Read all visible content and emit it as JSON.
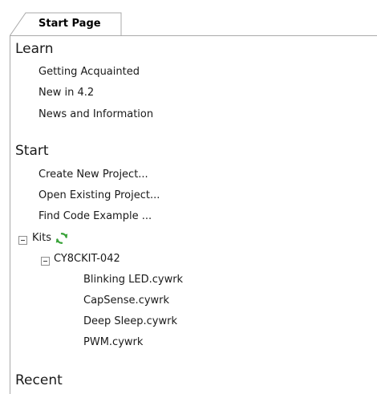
{
  "tab": {
    "label": "Start Page"
  },
  "learn": {
    "title": "Learn",
    "items": [
      "Getting Acquainted",
      "New in 4.2",
      "News and Information"
    ]
  },
  "start": {
    "title": "Start",
    "items": [
      "Create New Project...",
      "Open Existing Project...",
      "Find Code Example ..."
    ]
  },
  "kits": {
    "label": "Kits",
    "refresh_icon": "refresh-icon",
    "kit": {
      "label": "CY8CKIT-042",
      "files": [
        "Blinking LED.cywrk",
        "CapSense.cywrk",
        "Deep Sleep.cywrk",
        "PWM.cywrk"
      ]
    }
  },
  "recent": {
    "title": "Recent"
  },
  "colors": {
    "border": "#a9a9a9",
    "refresh_green": "#3aa33a",
    "text": "#1a1a1a"
  }
}
